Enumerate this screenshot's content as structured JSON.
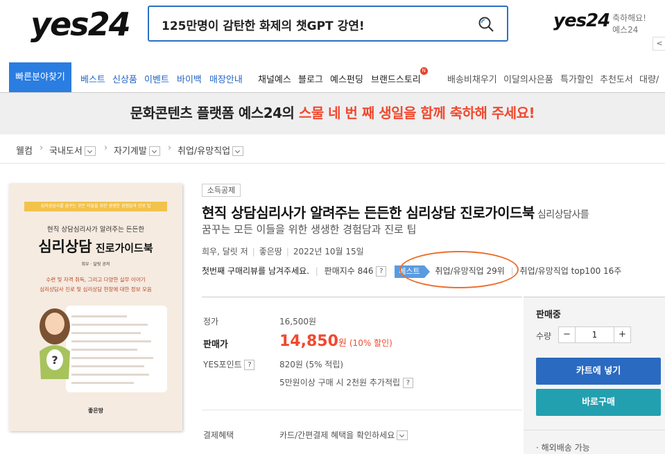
{
  "header": {
    "logo": "yes24",
    "search_text": "125만명이 감탄한 화제의 챗GPT 강연!",
    "small_logo": "yes24",
    "promo_line1": "축하해요!",
    "promo_line2": "예스24",
    "promo_arrow": "<"
  },
  "nav": {
    "find": "빠른분야찾기",
    "items_blue": [
      "베스트",
      "신상품",
      "이벤트",
      "바이백",
      "매장안내"
    ],
    "items_dark": [
      "채널예스",
      "블로그",
      "예스펀딩",
      "브랜드스토리"
    ],
    "new_badge": "N",
    "items_grey": [
      "배송비채우기",
      "이달의사은품",
      "특가할인",
      "추천도서",
      "대량/"
    ]
  },
  "banner": {
    "text": "문화콘텐츠 플랫폼 예스24의 ",
    "highlight": "스물 네 번 째 생일을 함께 축하해 주세요!"
  },
  "breadcrumb": {
    "home": "웰컴",
    "items": [
      "국내도서",
      "자기계발",
      "취업/유망직업"
    ]
  },
  "cover": {
    "top_bar": "심리상담사를 꿈꾸는 모든 이들을 위한 생생한 경험담과 진로 팁",
    "sub": "현직 상담심리사가 알려주는 든든한",
    "title_big": "심리상담",
    "title_small": " 진로가이드북",
    "author": "희우 · 달릿 공저",
    "desc1": "수련 및 자격 취득, 그리고 다양한 실무 이야기",
    "desc2": "심리상담사 진로 및 심리상담 현장에 대한 정보 모음",
    "publisher": "좋은땅"
  },
  "product": {
    "tax_tag": "소득공제",
    "title": "현직 상담심리사가 알려주는 든든한 심리상담 진로가이드북",
    "title_suffix": "심리상담사를",
    "subtitle": "꿈꾸는 모든 이들을 위한 생생한 경험담과 진로 팁",
    "author": "희우, 달릿 저",
    "publisher": "좋은땅",
    "date": "2022년 10월 15일",
    "review_prompt": "첫번째 구매리뷰를 남겨주세요.",
    "sales_index": "판매지수 846",
    "qmark": "?",
    "best_tag": "베스트",
    "rank1": "취업/유망직업 29위",
    "rank2": "취업/유망직업 top100 16주"
  },
  "price": {
    "list_label": "정가",
    "list_value": "16,500원",
    "sale_label": "판매가",
    "sale_value": "14,850",
    "sale_unit": "원",
    "discount": "(10% 할인)",
    "points_label": "YES포인트",
    "points_value": "820원 (5% 적립)",
    "extra_points": "5만원이상 구매 시 2천원 추가적립",
    "payment_label": "결제혜택",
    "payment_value": "카드/간편결제 혜택을 확인하세요"
  },
  "buy": {
    "status": "판매중",
    "qty_label": "수량",
    "qty_minus": "−",
    "qty_value": "1",
    "qty_plus": "+",
    "cart": "카트에 넣기",
    "buy_now": "바로구매",
    "overseas": "· 해외배송 가능"
  },
  "colors": {
    "brand_blue": "#2a7de1",
    "accent_red": "#f0492f",
    "cart_blue": "#2b6ac1",
    "buy_teal": "#22a0b0",
    "highlight_orange": "#ef6d2a"
  }
}
